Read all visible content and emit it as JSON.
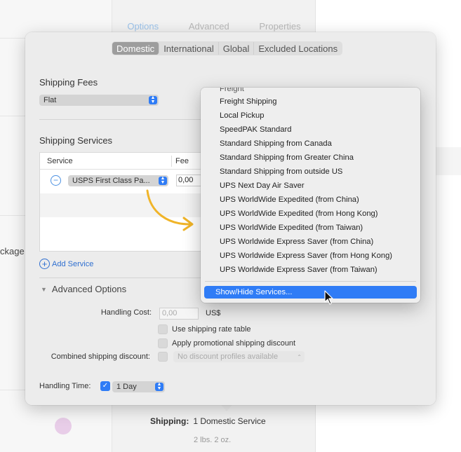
{
  "background": {
    "tabs": [
      "Options",
      "Advanced",
      "Properties"
    ],
    "fragment_text": "ckage",
    "shipping_label": "Shipping:",
    "shipping_value": "1 Domestic Service",
    "weight": "2 lbs. 2 oz."
  },
  "segments": [
    "Domestic",
    "International",
    "Global",
    "Excluded Locations"
  ],
  "shipping_fees": {
    "label": "Shipping Fees",
    "value": "Flat"
  },
  "shipping_services": {
    "label": "Shipping Services",
    "columns": [
      "Service",
      "Fee"
    ],
    "rows": [
      {
        "service": "USPS First Class Pa...",
        "fee": "0,00"
      }
    ],
    "add_label": "Add Service"
  },
  "advanced": {
    "label": "Advanced Options",
    "handling_cost_label": "Handling Cost:",
    "handling_cost_placeholder": "0,00",
    "currency": "US$",
    "use_rate_table": "Use shipping rate table",
    "apply_promo": "Apply promotional shipping discount",
    "combined_label": "Combined shipping discount:",
    "combined_value": "No discount profiles available"
  },
  "handling_time": {
    "label": "Handling Time:",
    "value": "1 Day"
  },
  "menu": {
    "items": [
      "Freight",
      "Freight Shipping",
      "Local Pickup",
      "SpeedPAK Standard",
      "Standard Shipping from Canada",
      "Standard Shipping from Greater China",
      "Standard Shipping from outside US",
      "UPS Next Day Air Saver",
      "UPS WorldWide Expedited (from China)",
      "UPS WorldWide Expedited (from Hong Kong)",
      "UPS WorldWide Expedited (from Taiwan)",
      "UPS Worldwide Express Saver (from China)",
      "UPS Worldwide Express Saver (from Hong Kong)",
      "UPS Worldwide Express Saver (from Taiwan)"
    ],
    "highlighted": "Show/Hide Services..."
  },
  "colors": {
    "accent": "#2f7cf6",
    "link": "#2f6fd0",
    "arrow": "#f0b428"
  }
}
